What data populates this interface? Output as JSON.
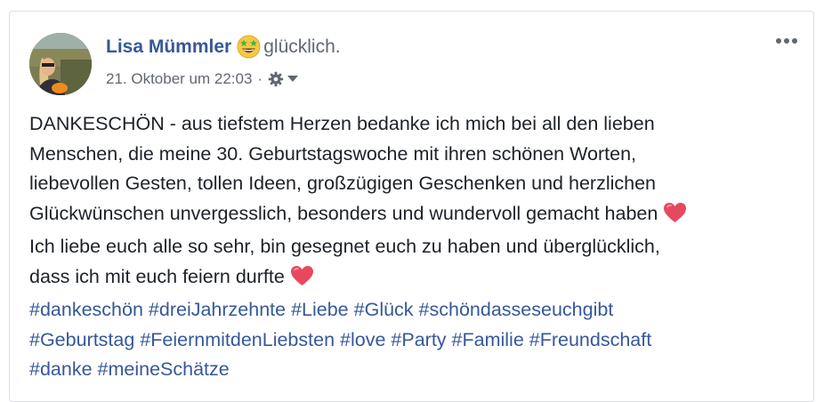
{
  "post": {
    "author": "Lisa Mümmler",
    "feeling": "glücklich.",
    "feeling_icon": "grinning-star-eyes-emoji",
    "timestamp": "21. Oktober um 22:03",
    "separator": "·",
    "privacy_icon": "gear-icon",
    "menu_icon": "more-options-icon",
    "text_lines": [
      "DANKESCHÖN - aus tiefstem Herzen bedanke ich mich bei all den lieben",
      "Menschen, die meine 30. Geburtstagswoche mit ihren schönen Worten,",
      "liebevollen Gesten, tollen Ideen, großzügigen Geschenken und herzlichen",
      "Glückwünschen unvergesslich, besonders und wundervoll gemacht haben",
      "Ich liebe euch alle so sehr, bin gesegnet euch zu haben und überglücklich,",
      "dass ich mit euch feiern durfte"
    ],
    "hashtag_lines": [
      [
        "#dankeschön",
        "#dreiJahrzehnte",
        "#Liebe",
        "#Glück",
        "#schöndasseseuchgibt"
      ],
      [
        "#Geburtstag",
        "#FeiernmitdenLiebsten",
        "#love",
        "#Party",
        "#Familie",
        "#Freundschaft"
      ],
      [
        "#danke",
        "#meineSchätze"
      ]
    ]
  },
  "colors": {
    "link": "#365899",
    "text": "#1d2129",
    "meta": "#616770",
    "heart": "#e8485f"
  }
}
